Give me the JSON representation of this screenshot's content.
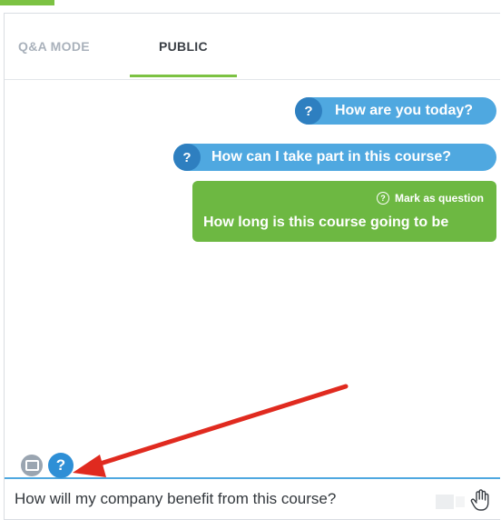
{
  "tabs": {
    "qa_mode": "Q&A MODE",
    "public": "PUBLIC"
  },
  "messages": [
    {
      "type": "question",
      "badge": "?",
      "text": "How are you today?"
    },
    {
      "type": "question",
      "badge": "?",
      "text": "How can I take part in this course?"
    },
    {
      "type": "message",
      "mark_label": "Mark as question",
      "mark_badge": "?",
      "text": "How long is this course going to be"
    }
  ],
  "composer": {
    "chat_icon": "chat-bubble-icon",
    "question_icon_label": "?",
    "input_value": "How will my company benefit from this course?",
    "raise_hand_icon": "raise-hand-icon"
  },
  "colors": {
    "accent_green": "#7cc243",
    "bubble_blue": "#4fa8e0",
    "badge_blue": "#2e7fc0",
    "bubble_green": "#6db842",
    "annotation_red": "#e02a1f"
  }
}
